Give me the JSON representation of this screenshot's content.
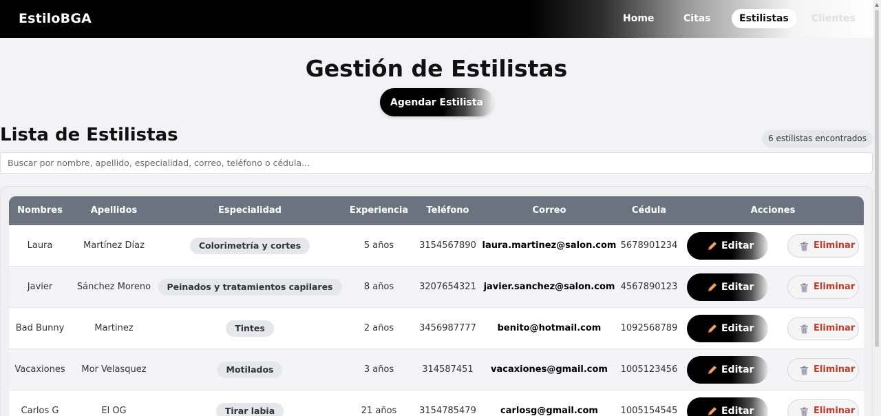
{
  "app": {
    "brand": "EstiloBGA"
  },
  "nav": {
    "home": "Home",
    "citas": "Citas",
    "estilistas": "Estilistas",
    "clientes": "Clientes"
  },
  "header": {
    "title": "Gestión de Estilistas",
    "agendar_label": "Agendar Estilista"
  },
  "list": {
    "title": "Lista de Estilistas",
    "count_label": "6 estilistas encontrados"
  },
  "search": {
    "placeholder": "Buscar por nombre, apellido, especialidad, correo, teléfono o cédula..."
  },
  "table": {
    "headers": {
      "nombres": "Nombres",
      "apellidos": "Apellidos",
      "especialidad": "Especialidad",
      "experiencia": "Experiencia",
      "telefono": "Teléfono",
      "correo": "Correo",
      "cedula": "Cédula",
      "acciones": "Acciones"
    },
    "edit_label": "Editar",
    "delete_label": "Eliminar",
    "rows": [
      {
        "nombres": "Laura",
        "apellidos": "Martínez Díaz",
        "especialidad": "Colorimetría y cortes",
        "experiencia": "5 años",
        "telefono": "3154567890",
        "correo": "laura.martinez@salon.com",
        "cedula": "5678901234"
      },
      {
        "nombres": "Javier",
        "apellidos": "Sánchez Moreno",
        "especialidad": "Peinados y tratamientos capilares",
        "experiencia": "8 años",
        "telefono": "3207654321",
        "correo": "javier.sanchez@salon.com",
        "cedula": "4567890123"
      },
      {
        "nombres": "Bad Bunny",
        "apellidos": "Martinez",
        "especialidad": "Tintes",
        "experiencia": "2 años",
        "telefono": "3456987777",
        "correo": "benito@hotmail.com",
        "cedula": "1092568789"
      },
      {
        "nombres": "Vacaxiones",
        "apellidos": "Mor Velasquez",
        "especialidad": "Motilados",
        "experiencia": "3 años",
        "telefono": "314587451",
        "correo": "vacaxiones@gmail.com",
        "cedula": "1005123456"
      },
      {
        "nombres": "Carlos G",
        "apellidos": "El OG",
        "especialidad": "Tirar labia",
        "experiencia": "21 años",
        "telefono": "3154785479",
        "correo": "carlosg@gmail.com",
        "cedula": "1005154545"
      }
    ]
  },
  "colors": {
    "header_bg": "#6b7280",
    "danger": "#c0392b",
    "pill_bg": "#e6e7ea",
    "page_bg": "#f3f3f5"
  },
  "icons": {
    "edit": "pencil-icon",
    "delete": "trash-icon"
  }
}
